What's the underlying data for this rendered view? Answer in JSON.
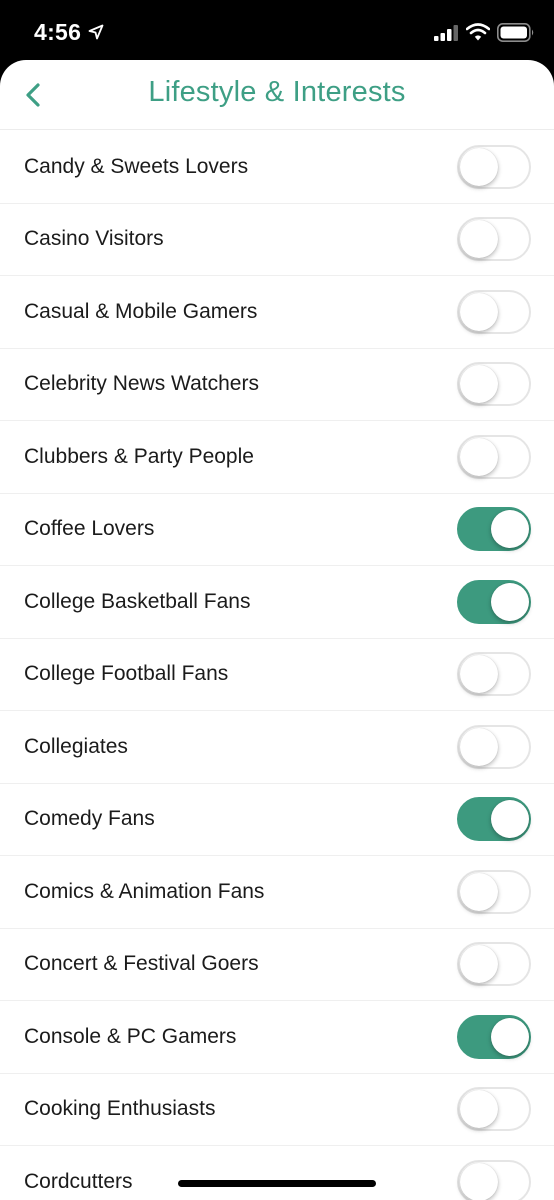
{
  "status_bar": {
    "time": "4:56"
  },
  "header": {
    "title": "Lifestyle & Interests",
    "back_icon": "chevron-left-icon"
  },
  "colors": {
    "accent": "#3e9f85",
    "toggle_on": "#3d9a7f"
  },
  "items": [
    {
      "label": "Candy & Sweets Lovers",
      "enabled": false
    },
    {
      "label": "Casino Visitors",
      "enabled": false
    },
    {
      "label": "Casual & Mobile Gamers",
      "enabled": false
    },
    {
      "label": "Celebrity News Watchers",
      "enabled": false
    },
    {
      "label": "Clubbers & Party People",
      "enabled": false
    },
    {
      "label": "Coffee Lovers",
      "enabled": true
    },
    {
      "label": "College Basketball Fans",
      "enabled": true
    },
    {
      "label": "College Football Fans",
      "enabled": false
    },
    {
      "label": "Collegiates",
      "enabled": false
    },
    {
      "label": "Comedy Fans",
      "enabled": true
    },
    {
      "label": "Comics & Animation Fans",
      "enabled": false
    },
    {
      "label": "Concert & Festival Goers",
      "enabled": false
    },
    {
      "label": "Console & PC Gamers",
      "enabled": true
    },
    {
      "label": "Cooking Enthusiasts",
      "enabled": false
    },
    {
      "label": "Cordcutters",
      "enabled": false
    }
  ]
}
